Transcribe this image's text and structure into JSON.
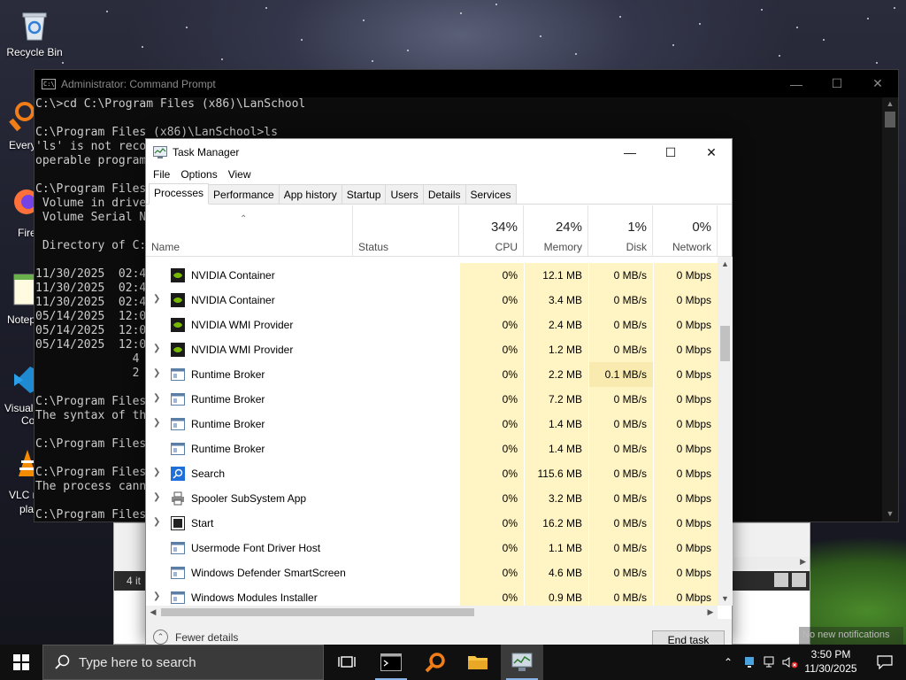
{
  "desktop": {
    "recycle_bin_label": "Recycle Bin",
    "partial_labels": [
      "Every",
      "Fire",
      "Notep",
      "Visual",
      "Co",
      "VLC r",
      "pla"
    ]
  },
  "cmd": {
    "title": "Administrator: Command Prompt",
    "lines": [
      "C:\\>cd C:\\Program Files (x86)\\LanSchool",
      "",
      "C:\\Program Files (x86)\\LanSchool>ls",
      "'ls' is not reco",
      "operable program",
      "",
      "C:\\Program Files",
      " Volume in drive",
      " Volume Serial N",
      "",
      " Directory of C:",
      "",
      "11/30/2025  02:4",
      "11/30/2025  02:4",
      "11/30/2025  02:4",
      "05/14/2025  12:0",
      "05/14/2025  12:0",
      "05/14/2025  12:0",
      "              4",
      "              2",
      "",
      "C:\\Program Files",
      "The syntax of th",
      "",
      "C:\\Program Files",
      "",
      "C:\\Program Files",
      "The process cann",
      "",
      "C:\\Program Files"
    ]
  },
  "explorer": {
    "status_text": "4 it"
  },
  "taskmgr": {
    "title": "Task Manager",
    "menu": [
      "File",
      "Options",
      "View"
    ],
    "tabs": [
      "Processes",
      "Performance",
      "App history",
      "Startup",
      "Users",
      "Details",
      "Services"
    ],
    "active_tab": "Processes",
    "columns": {
      "name": "Name",
      "status": "Status",
      "cpu": {
        "pct": "34%",
        "label": "CPU"
      },
      "memory": {
        "pct": "24%",
        "label": "Memory"
      },
      "disk": {
        "pct": "1%",
        "label": "Disk"
      },
      "network": {
        "pct": "0%",
        "label": "Network"
      }
    },
    "rows": [
      {
        "name": "NVIDIA Container",
        "expandable": false,
        "icon": "nvidia-icon",
        "cpu": "0%",
        "mem": "12.1 MB",
        "disk": "0 MB/s",
        "net": "0 Mbps"
      },
      {
        "name": "NVIDIA Container",
        "expandable": true,
        "icon": "nvidia-icon",
        "cpu": "0%",
        "mem": "3.4 MB",
        "disk": "0 MB/s",
        "net": "0 Mbps"
      },
      {
        "name": "NVIDIA WMI Provider",
        "expandable": false,
        "icon": "nvidia-icon",
        "cpu": "0%",
        "mem": "2.4 MB",
        "disk": "0 MB/s",
        "net": "0 Mbps"
      },
      {
        "name": "NVIDIA WMI Provider",
        "expandable": true,
        "icon": "nvidia-icon",
        "cpu": "0%",
        "mem": "1.2 MB",
        "disk": "0 MB/s",
        "net": "0 Mbps"
      },
      {
        "name": "Runtime Broker",
        "expandable": true,
        "icon": "app-window-icon",
        "cpu": "0%",
        "mem": "2.2 MB",
        "disk": "0.1 MB/s",
        "net": "0 Mbps",
        "disk_hot": true
      },
      {
        "name": "Runtime Broker",
        "expandable": true,
        "icon": "app-window-icon",
        "cpu": "0%",
        "mem": "7.2 MB",
        "disk": "0 MB/s",
        "net": "0 Mbps"
      },
      {
        "name": "Runtime Broker",
        "expandable": true,
        "icon": "app-window-icon",
        "cpu": "0%",
        "mem": "1.4 MB",
        "disk": "0 MB/s",
        "net": "0 Mbps"
      },
      {
        "name": "Runtime Broker",
        "expandable": false,
        "icon": "app-window-icon",
        "cpu": "0%",
        "mem": "1.4 MB",
        "disk": "0 MB/s",
        "net": "0 Mbps"
      },
      {
        "name": "Search",
        "expandable": true,
        "icon": "search-app-icon",
        "cpu": "0%",
        "mem": "115.6 MB",
        "disk": "0 MB/s",
        "net": "0 Mbps"
      },
      {
        "name": "Spooler SubSystem App",
        "expandable": true,
        "icon": "printer-icon",
        "cpu": "0%",
        "mem": "3.2 MB",
        "disk": "0 MB/s",
        "net": "0 Mbps"
      },
      {
        "name": "Start",
        "expandable": true,
        "icon": "start-app-icon",
        "cpu": "0%",
        "mem": "16.2 MB",
        "disk": "0 MB/s",
        "net": "0 Mbps"
      },
      {
        "name": "Usermode Font Driver Host",
        "expandable": false,
        "icon": "app-window-icon",
        "cpu": "0%",
        "mem": "1.1 MB",
        "disk": "0 MB/s",
        "net": "0 Mbps"
      },
      {
        "name": "Windows Defender SmartScreen",
        "expandable": false,
        "icon": "app-window-icon",
        "cpu": "0%",
        "mem": "4.6 MB",
        "disk": "0 MB/s",
        "net": "0 Mbps"
      },
      {
        "name": "Windows Modules Installer",
        "expandable": true,
        "icon": "app-window-icon",
        "cpu": "0%",
        "mem": "0.9 MB",
        "disk": "0 MB/s",
        "net": "0 Mbps"
      }
    ],
    "footer": {
      "fewer_details": "Fewer details",
      "end_task": "End task"
    }
  },
  "toast": {
    "text": "No new notifications"
  },
  "taskbar": {
    "search_placeholder": "Type here to search",
    "clock": {
      "time": "3:50 PM",
      "date": "11/30/2025"
    }
  }
}
